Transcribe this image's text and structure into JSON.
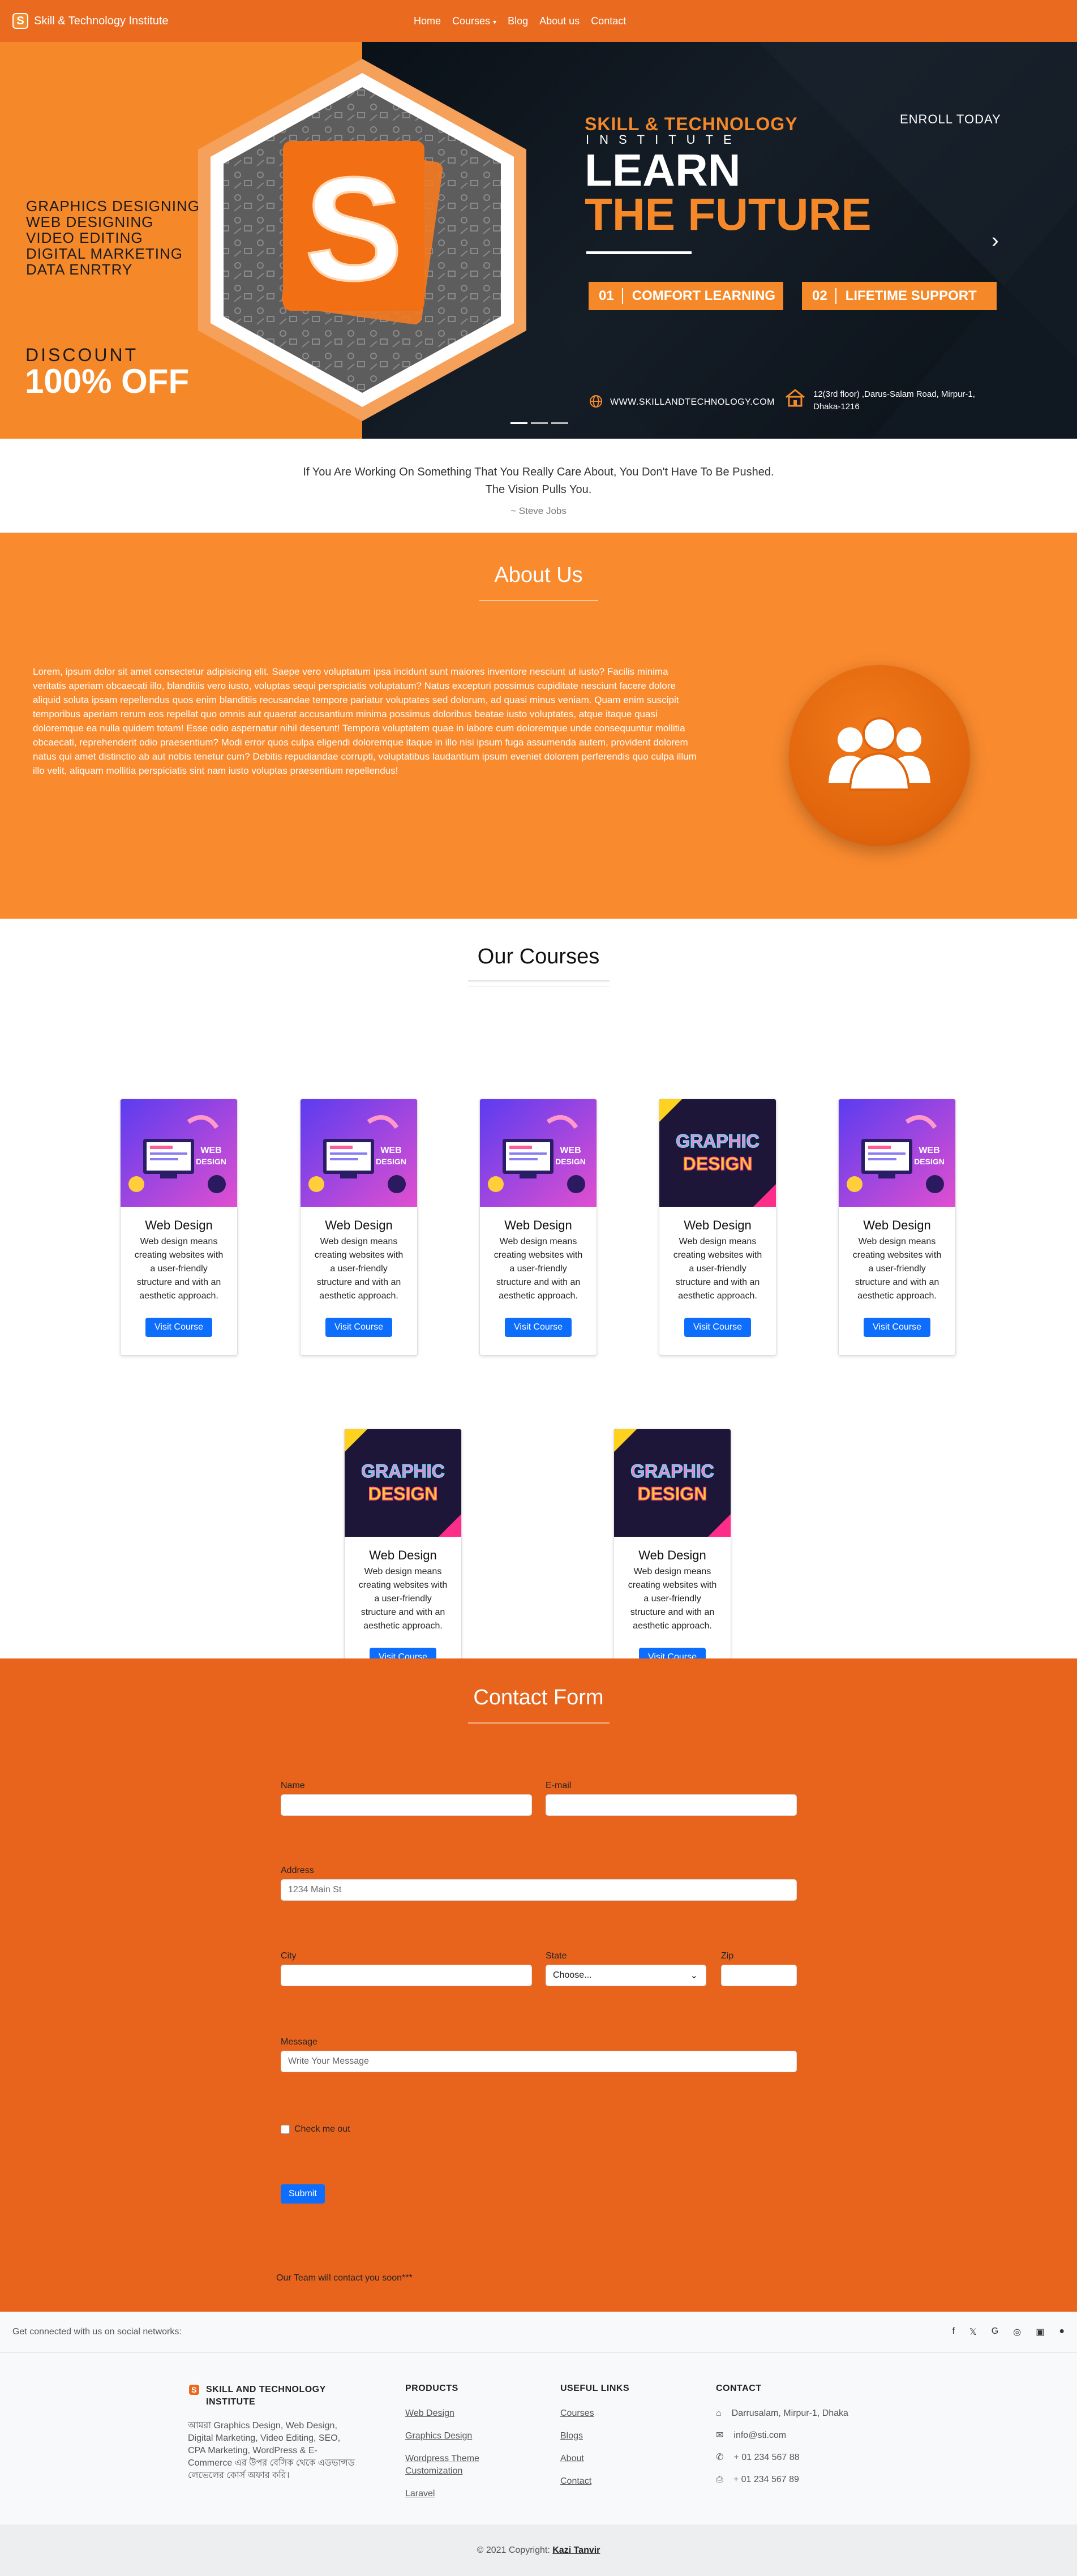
{
  "nav": {
    "brand": "Skill & Technology Institute",
    "logo_letter": "S",
    "items": [
      "Home",
      "Courses",
      "Blog",
      "About us",
      "Contact"
    ],
    "courses_caret": "▾"
  },
  "hero": {
    "skills": [
      "GRAPHICS DESIGNING",
      "WEB DESIGNING",
      "VIDEO EDITING",
      "DIGITAL MARKETING",
      "DATA ENRTRY"
    ],
    "discount_label": "DISCOUNT",
    "discount_value": "100% OFF",
    "institute_line1": "SKILL & TECHNOLOGY",
    "institute_line2": "INSTITUTE",
    "learn": "LEARN",
    "future": "THE FUTURE",
    "enroll": "ENROLL TODAY",
    "pill1_num": "01",
    "pill1_text": "COMFORT LEARNING",
    "pill2_num": "02",
    "pill2_text": "LIFETIME SUPPORT",
    "website": "WWW.SKILLANDTECHNOLOGY.COM",
    "address_line1": "12(3rd floor) ,Darus-Salam Road, Mirpur-1,",
    "address_line2": "Dhaka-1216",
    "logo_letter": "S",
    "accent_color": "#f5892a"
  },
  "quote": {
    "line1": "If You Are Working On Something That You Really Care About, You Don't Have To Be Pushed.",
    "line2": "The Vision Pulls You.",
    "author": "~  Steve Jobs"
  },
  "about": {
    "title": "About Us",
    "text": "Lorem, ipsum dolor sit amet consectetur adipisicing elit. Saepe vero voluptatum ipsa incidunt sunt maiores inventore nesciunt ut iusto? Facilis minima veritatis aperiam obcaecati illo, blanditiis vero iusto, voluptas sequi perspiciatis voluptatum? Natus excepturi possimus cupiditate nesciunt facere dolore aliquid soluta ipsam repellendus quos enim blanditiis recusandae tempore pariatur voluptates sed dolorum, ad quasi minus veniam. Quam enim suscipit temporibus aperiam rerum eos repellat quo omnis aut quaerat accusantium minima possimus doloribus beatae iusto voluptates, atque itaque quasi doloremque ea nulla quidem totam! Esse odio aspernatur nihil deserunt! Tempora voluptatem quae in labore cum doloremque unde consequuntur mollitia obcaecati, reprehenderit odio praesentium? Modi error quos culpa eligendi doloremque itaque in illo nisi ipsum fuga assumenda autem, provident dolorem natus qui amet distinctio ab aut nobis tenetur cum? Debitis repudiandae corrupti, voluptatibus laudantium ipsum eveniet dolorem perferendis quo culpa illum illo velit, aliquam mollitia perspiciatis sint nam iusto voluptas praesentium repellendus!"
  },
  "courses": {
    "title": "Our Courses",
    "cards": [
      {
        "thumb": "web",
        "title": "Web Design",
        "desc": "Web design means creating websites with a user-friendly structure and with an aesthetic approach.",
        "button": "Visit Course"
      },
      {
        "thumb": "web",
        "title": "Web Design",
        "desc": "Web design means creating websites with a user-friendly structure and with an aesthetic approach.",
        "button": "Visit Course"
      },
      {
        "thumb": "web",
        "title": "Web Design",
        "desc": "Web design means creating websites with a user-friendly structure and with an aesthetic approach.",
        "button": "Visit Course"
      },
      {
        "thumb": "graphic",
        "title": "Web Design",
        "desc": "Web design means creating websites with a user-friendly structure and with an aesthetic approach.",
        "button": "Visit Course"
      },
      {
        "thumb": "web",
        "title": "Web Design",
        "desc": "Web design means creating websites with a user-friendly structure and with an aesthetic approach.",
        "button": "Visit Course"
      },
      {
        "thumb": "graphic",
        "title": "Web Design",
        "desc": "Web design means creating websites with a user-friendly structure and with an aesthetic approach.",
        "button": "Visit Course"
      },
      {
        "thumb": "graphic",
        "title": "Web Design",
        "desc": "Web design means creating websites with a user-friendly structure and with an aesthetic approach.",
        "button": "Visit Course"
      }
    ],
    "thumb_web_line1": "WEB",
    "thumb_web_line2": "DESIGN",
    "thumb_graphic_line1": "GRAPHIC",
    "thumb_graphic_line2": "DESIGN"
  },
  "contact": {
    "title": "Contact Form",
    "name_label": "Name",
    "email_label": "E-mail",
    "address_label": "Address",
    "address_placeholder": "1234 Main St",
    "city_label": "City",
    "state_label": "State",
    "state_value": "Choose...",
    "zip_label": "Zip",
    "message_label": "Message",
    "message_placeholder": "Write Your Message",
    "checkbox_label": "Check me out",
    "submit": "Submit",
    "note": "Our Team will contact you soon***"
  },
  "social": {
    "text": "Get connected with us on social networks:",
    "icons": [
      "facebook-icon",
      "twitter-icon",
      "google-icon",
      "instagram-icon",
      "linkedin-icon",
      "github-icon"
    ]
  },
  "footer": {
    "brand_title": "SKILL AND TECHNOLOGY INSTITUTE",
    "brand_logo": "S",
    "brand_text": "আমরা Graphics Design, Web Design, Digital Marketing, Video Editing, SEO, CPA Marketing, WordPress & E-Commerce এর উপর বেসিক থেকে এডভান্সড লেভেলের কোর্স অফার করি।",
    "products_title": "PRODUCTS",
    "products": [
      "Web Design",
      "Graphics Design",
      "Wordpress Theme Customization",
      "Laravel"
    ],
    "links_title": "USEFUL LINKS",
    "links": [
      "Courses",
      "Blogs",
      "About",
      "Contact"
    ],
    "contact_title": "CONTACT",
    "contact_address": "Darrusalam, Mirpur-1, Dhaka",
    "contact_email": "info@sti.com",
    "contact_phone": "+ 01 234 567 88",
    "contact_fax": "+ 01 234 567 89"
  },
  "copyright": {
    "prefix": "© 2021 Copyright:",
    "author": "Kazi Tanvir"
  }
}
